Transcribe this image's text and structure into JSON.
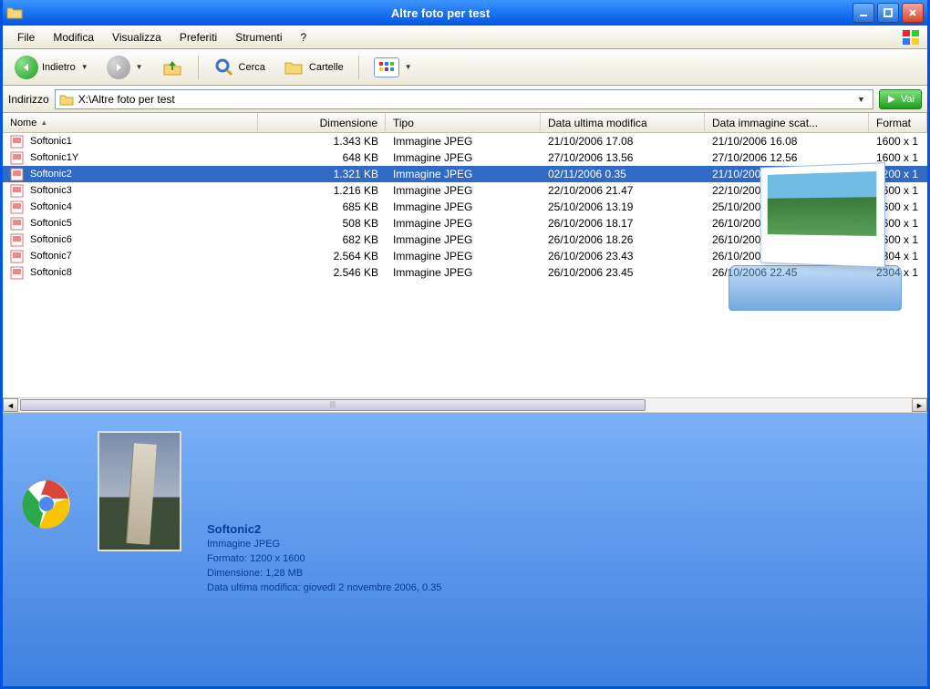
{
  "window": {
    "title": "Altre foto per test"
  },
  "menu": {
    "file": "File",
    "edit": "Modifica",
    "view": "Visualizza",
    "fav": "Preferiti",
    "tools": "Strumenti",
    "help": "?"
  },
  "toolbar": {
    "back": "Indietro",
    "search": "Cerca",
    "folders": "Cartelle"
  },
  "address": {
    "label": "Indirizzo",
    "path": "X:\\Altre foto per test",
    "go": "Vai"
  },
  "columns": {
    "name": "Nome",
    "size": "Dimensione",
    "type": "Tipo",
    "modified": "Data ultima modifica",
    "shot": "Data immagine scat...",
    "format": "Format"
  },
  "files": [
    {
      "name": "Softonic1",
      "size": "1.343 KB",
      "type": "Immagine JPEG",
      "modified": "21/10/2006 17.08",
      "shot": "21/10/2006 16.08",
      "format": "1600 x 1"
    },
    {
      "name": "Softonic1Y",
      "size": "648 KB",
      "type": "Immagine JPEG",
      "modified": "27/10/2006 13.56",
      "shot": "27/10/2006 12.56",
      "format": "1600 x 1"
    },
    {
      "name": "Softonic2",
      "size": "1.321 KB",
      "type": "Immagine JPEG",
      "modified": "02/11/2006 0.35",
      "shot": "21/10/2006 17.26",
      "format": "1200 x 1",
      "selected": true
    },
    {
      "name": "Softonic3",
      "size": "1.216 KB",
      "type": "Immagine JPEG",
      "modified": "22/10/2006 21.47",
      "shot": "22/10/2006 20.47",
      "format": "1600 x 1"
    },
    {
      "name": "Softonic4",
      "size": "685 KB",
      "type": "Immagine JPEG",
      "modified": "25/10/2006 13.19",
      "shot": "25/10/2006 12.19",
      "format": "1600 x 1"
    },
    {
      "name": "Softonic5",
      "size": "508 KB",
      "type": "Immagine JPEG",
      "modified": "26/10/2006 18.17",
      "shot": "26/10/2006 17.17",
      "format": "1600 x 1"
    },
    {
      "name": "Softonic6",
      "size": "682 KB",
      "type": "Immagine JPEG",
      "modified": "26/10/2006 18.26",
      "shot": "26/10/2006 17.26",
      "format": "1600 x 1"
    },
    {
      "name": "Softonic7",
      "size": "2.564 KB",
      "type": "Immagine JPEG",
      "modified": "26/10/2006 23.43",
      "shot": "26/10/2006 22.43",
      "format": "2304 x 1"
    },
    {
      "name": "Softonic8",
      "size": "2.546 KB",
      "type": "Immagine JPEG",
      "modified": "26/10/2006 23.45",
      "shot": "26/10/2006 22.45",
      "format": "2304 x 1"
    }
  ],
  "details": {
    "name": "Softonic2",
    "type": "Immagine JPEG",
    "format_label": "Formato: 1200 x 1600",
    "size_label": "Dimensione: 1,28 MB",
    "modified_label": "Data ultima modifica: giovedì 2 novembre 2006, 0.35"
  }
}
